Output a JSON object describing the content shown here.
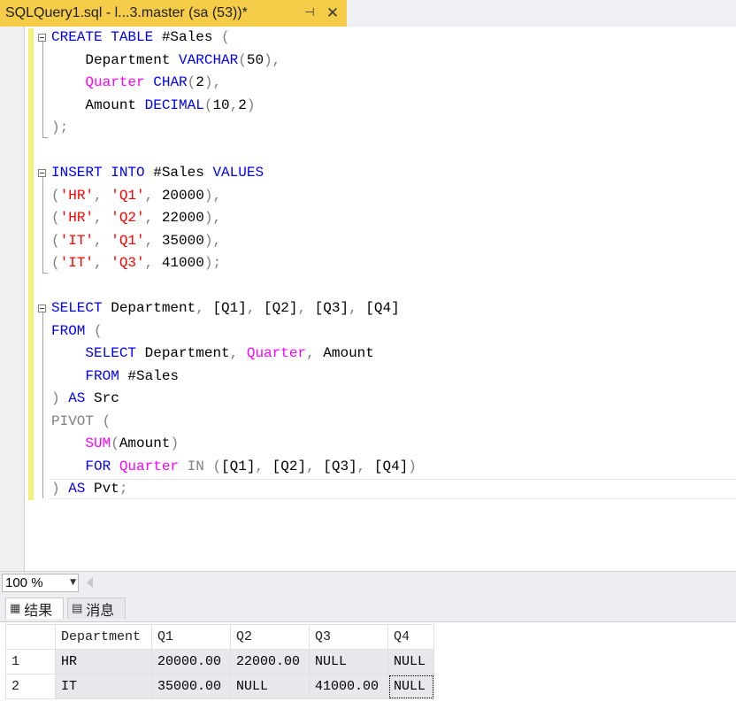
{
  "tab": {
    "title": "SQLQuery1.sql - l...3.master (sa (53))*",
    "pin_icon": "pin-icon",
    "close_icon": "close-icon"
  },
  "editor": {
    "lines": [
      [
        {
          "t": "kw",
          "v": "CREATE TABLE "
        },
        {
          "t": "tx",
          "v": "#Sales "
        },
        {
          "t": "op",
          "v": "("
        }
      ],
      [
        {
          "t": "tx",
          "v": "    Department "
        },
        {
          "t": "kw",
          "v": "VARCHAR"
        },
        {
          "t": "op",
          "v": "("
        },
        {
          "t": "tx",
          "v": "50"
        },
        {
          "t": "op",
          "v": "),"
        }
      ],
      [
        {
          "t": "tx",
          "v": "    "
        },
        {
          "t": "fn",
          "v": "Quarter"
        },
        {
          "t": "tx",
          "v": " "
        },
        {
          "t": "kw",
          "v": "CHAR"
        },
        {
          "t": "op",
          "v": "("
        },
        {
          "t": "tx",
          "v": "2"
        },
        {
          "t": "op",
          "v": "),"
        }
      ],
      [
        {
          "t": "tx",
          "v": "    Amount "
        },
        {
          "t": "kw",
          "v": "DECIMAL"
        },
        {
          "t": "op",
          "v": "("
        },
        {
          "t": "tx",
          "v": "10"
        },
        {
          "t": "op",
          "v": ","
        },
        {
          "t": "tx",
          "v": "2"
        },
        {
          "t": "op",
          "v": ")"
        }
      ],
      [
        {
          "t": "op",
          "v": ");"
        }
      ],
      [],
      [
        {
          "t": "kw",
          "v": "INSERT INTO "
        },
        {
          "t": "tx",
          "v": "#Sales "
        },
        {
          "t": "kw",
          "v": "VALUES"
        }
      ],
      [
        {
          "t": "op",
          "v": "("
        },
        {
          "t": "str",
          "v": "'HR'"
        },
        {
          "t": "op",
          "v": ", "
        },
        {
          "t": "str",
          "v": "'Q1'"
        },
        {
          "t": "op",
          "v": ", "
        },
        {
          "t": "tx",
          "v": "20000"
        },
        {
          "t": "op",
          "v": "),"
        }
      ],
      [
        {
          "t": "op",
          "v": "("
        },
        {
          "t": "str",
          "v": "'HR'"
        },
        {
          "t": "op",
          "v": ", "
        },
        {
          "t": "str",
          "v": "'Q2'"
        },
        {
          "t": "op",
          "v": ", "
        },
        {
          "t": "tx",
          "v": "22000"
        },
        {
          "t": "op",
          "v": "),"
        }
      ],
      [
        {
          "t": "op",
          "v": "("
        },
        {
          "t": "str",
          "v": "'IT'"
        },
        {
          "t": "op",
          "v": ", "
        },
        {
          "t": "str",
          "v": "'Q1'"
        },
        {
          "t": "op",
          "v": ", "
        },
        {
          "t": "tx",
          "v": "35000"
        },
        {
          "t": "op",
          "v": "),"
        }
      ],
      [
        {
          "t": "op",
          "v": "("
        },
        {
          "t": "str",
          "v": "'IT'"
        },
        {
          "t": "op",
          "v": ", "
        },
        {
          "t": "str",
          "v": "'Q3'"
        },
        {
          "t": "op",
          "v": ", "
        },
        {
          "t": "tx",
          "v": "41000"
        },
        {
          "t": "op",
          "v": ");"
        }
      ],
      [],
      [
        {
          "t": "kw",
          "v": "SELECT "
        },
        {
          "t": "tx",
          "v": "Department"
        },
        {
          "t": "op",
          "v": ", "
        },
        {
          "t": "tx",
          "v": "[Q1]"
        },
        {
          "t": "op",
          "v": ", "
        },
        {
          "t": "tx",
          "v": "[Q2]"
        },
        {
          "t": "op",
          "v": ", "
        },
        {
          "t": "tx",
          "v": "[Q3]"
        },
        {
          "t": "op",
          "v": ", "
        },
        {
          "t": "tx",
          "v": "[Q4]"
        }
      ],
      [
        {
          "t": "kw",
          "v": "FROM "
        },
        {
          "t": "op",
          "v": "("
        }
      ],
      [
        {
          "t": "tx",
          "v": "    "
        },
        {
          "t": "kw",
          "v": "SELECT "
        },
        {
          "t": "tx",
          "v": "Department"
        },
        {
          "t": "op",
          "v": ", "
        },
        {
          "t": "fn",
          "v": "Quarter"
        },
        {
          "t": "op",
          "v": ", "
        },
        {
          "t": "tx",
          "v": "Amount"
        }
      ],
      [
        {
          "t": "tx",
          "v": "    "
        },
        {
          "t": "kw",
          "v": "FROM "
        },
        {
          "t": "tx",
          "v": "#Sales"
        }
      ],
      [
        {
          "t": "op",
          "v": ") "
        },
        {
          "t": "kw",
          "v": "AS "
        },
        {
          "t": "tx",
          "v": "Src"
        }
      ],
      [
        {
          "t": "op",
          "v": "PIVOT ("
        }
      ],
      [
        {
          "t": "tx",
          "v": "    "
        },
        {
          "t": "fn",
          "v": "SUM"
        },
        {
          "t": "op",
          "v": "("
        },
        {
          "t": "tx",
          "v": "Amount"
        },
        {
          "t": "op",
          "v": ")"
        }
      ],
      [
        {
          "t": "tx",
          "v": "    "
        },
        {
          "t": "kw",
          "v": "FOR "
        },
        {
          "t": "fn",
          "v": "Quarter"
        },
        {
          "t": "tx",
          "v": " "
        },
        {
          "t": "op",
          "v": "IN ("
        },
        {
          "t": "tx",
          "v": "[Q1]"
        },
        {
          "t": "op",
          "v": ", "
        },
        {
          "t": "tx",
          "v": "[Q2]"
        },
        {
          "t": "op",
          "v": ", "
        },
        {
          "t": "tx",
          "v": "[Q3]"
        },
        {
          "t": "op",
          "v": ", "
        },
        {
          "t": "tx",
          "v": "[Q4]"
        },
        {
          "t": "op",
          "v": ")"
        }
      ],
      [
        {
          "t": "op",
          "v": ") "
        },
        {
          "t": "kw",
          "v": "AS "
        },
        {
          "t": "tx",
          "v": "Pvt"
        },
        {
          "t": "op",
          "v": ";"
        }
      ]
    ],
    "colors": {
      "keyword": "#0000ff",
      "function": "#ff00ff",
      "string": "#ff0000",
      "operator": "#808080",
      "change_bar": "#f3f07a"
    }
  },
  "zoom": {
    "value": "100 %"
  },
  "results_tabs": {
    "results_label": "结果",
    "messages_label": "消息",
    "results_icon": "grid-icon",
    "messages_icon": "messages-icon"
  },
  "grid": {
    "columns": [
      "Department",
      "Q1",
      "Q2",
      "Q3",
      "Q4"
    ],
    "rows": [
      {
        "num": "1",
        "cells": [
          "HR",
          "20000.00",
          "22000.00",
          "NULL",
          "NULL"
        ]
      },
      {
        "num": "2",
        "cells": [
          "IT",
          "35000.00",
          "NULL",
          "41000.00",
          "NULL"
        ]
      }
    ]
  }
}
